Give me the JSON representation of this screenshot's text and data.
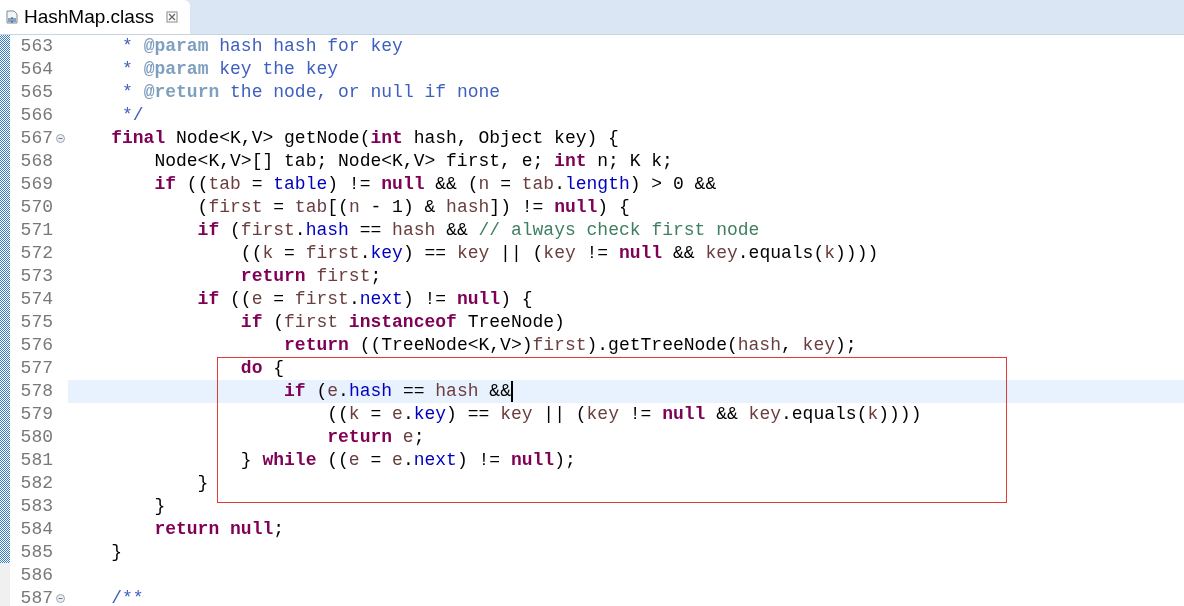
{
  "tab": {
    "title": "HashMap.class",
    "selected": true
  },
  "lines": [
    {
      "number": "563",
      "foldable": false,
      "current": false,
      "tokens": [
        {
          "kind": "doc",
          "text": "     * "
        },
        {
          "kind": "tag",
          "text": "@param"
        },
        {
          "kind": "doc",
          "text": " hash hash for key"
        }
      ]
    },
    {
      "number": "564",
      "foldable": false,
      "current": false,
      "tokens": [
        {
          "kind": "doc",
          "text": "     * "
        },
        {
          "kind": "tag",
          "text": "@param"
        },
        {
          "kind": "doc",
          "text": " key the key"
        }
      ]
    },
    {
      "number": "565",
      "foldable": false,
      "current": false,
      "tokens": [
        {
          "kind": "doc",
          "text": "     * "
        },
        {
          "kind": "tag",
          "text": "@return"
        },
        {
          "kind": "doc",
          "text": " the node, or null if none"
        }
      ]
    },
    {
      "number": "566",
      "foldable": false,
      "current": false,
      "tokens": [
        {
          "kind": "doc",
          "text": "     */"
        }
      ]
    },
    {
      "number": "567",
      "foldable": true,
      "current": false,
      "tokens": [
        {
          "kind": "kw",
          "text": "    final"
        },
        {
          "kind": "txt",
          "text": " Node<K,V> getNode("
        },
        {
          "kind": "kw",
          "text": "int"
        },
        {
          "kind": "txt",
          "text": " hash, Object key) {"
        }
      ]
    },
    {
      "number": "568",
      "foldable": false,
      "current": false,
      "tokens": [
        {
          "kind": "txt",
          "text": "        Node<K,V>[] tab; Node<K,V> first, e; "
        },
        {
          "kind": "kw",
          "text": "int"
        },
        {
          "kind": "txt",
          "text": " n; K k;"
        }
      ]
    },
    {
      "number": "569",
      "foldable": false,
      "current": false,
      "tokens": [
        {
          "kind": "kw",
          "text": "        if"
        },
        {
          "kind": "txt",
          "text": " (("
        },
        {
          "kind": "var",
          "text": "tab"
        },
        {
          "kind": "txt",
          "text": " = "
        },
        {
          "kind": "fld",
          "text": "table"
        },
        {
          "kind": "txt",
          "text": ") != "
        },
        {
          "kind": "kw",
          "text": "null"
        },
        {
          "kind": "txt",
          "text": " && ("
        },
        {
          "kind": "var",
          "text": "n"
        },
        {
          "kind": "txt",
          "text": " = "
        },
        {
          "kind": "var",
          "text": "tab"
        },
        {
          "kind": "txt",
          "text": "."
        },
        {
          "kind": "fld",
          "text": "length"
        },
        {
          "kind": "txt",
          "text": ") > 0 &&"
        }
      ]
    },
    {
      "number": "570",
      "foldable": false,
      "current": false,
      "tokens": [
        {
          "kind": "txt",
          "text": "            ("
        },
        {
          "kind": "var",
          "text": "first"
        },
        {
          "kind": "txt",
          "text": " = "
        },
        {
          "kind": "var",
          "text": "tab"
        },
        {
          "kind": "txt",
          "text": "[("
        },
        {
          "kind": "var",
          "text": "n"
        },
        {
          "kind": "txt",
          "text": " - 1) & "
        },
        {
          "kind": "var",
          "text": "hash"
        },
        {
          "kind": "txt",
          "text": "]) != "
        },
        {
          "kind": "kw",
          "text": "null"
        },
        {
          "kind": "txt",
          "text": ") {"
        }
      ]
    },
    {
      "number": "571",
      "foldable": false,
      "current": false,
      "tokens": [
        {
          "kind": "kw",
          "text": "            if"
        },
        {
          "kind": "txt",
          "text": " ("
        },
        {
          "kind": "var",
          "text": "first"
        },
        {
          "kind": "txt",
          "text": "."
        },
        {
          "kind": "fld",
          "text": "hash"
        },
        {
          "kind": "txt",
          "text": " == "
        },
        {
          "kind": "var",
          "text": "hash"
        },
        {
          "kind": "txt",
          "text": " && "
        },
        {
          "kind": "cmt",
          "text": "// always check first node"
        }
      ]
    },
    {
      "number": "572",
      "foldable": false,
      "current": false,
      "tokens": [
        {
          "kind": "txt",
          "text": "                (("
        },
        {
          "kind": "var",
          "text": "k"
        },
        {
          "kind": "txt",
          "text": " = "
        },
        {
          "kind": "var",
          "text": "first"
        },
        {
          "kind": "txt",
          "text": "."
        },
        {
          "kind": "fld",
          "text": "key"
        },
        {
          "kind": "txt",
          "text": ") == "
        },
        {
          "kind": "var",
          "text": "key"
        },
        {
          "kind": "txt",
          "text": " || ("
        },
        {
          "kind": "var",
          "text": "key"
        },
        {
          "kind": "txt",
          "text": " != "
        },
        {
          "kind": "kw",
          "text": "null"
        },
        {
          "kind": "txt",
          "text": " && "
        },
        {
          "kind": "var",
          "text": "key"
        },
        {
          "kind": "txt",
          "text": ".equals("
        },
        {
          "kind": "var",
          "text": "k"
        },
        {
          "kind": "txt",
          "text": "))))"
        }
      ]
    },
    {
      "number": "573",
      "foldable": false,
      "current": false,
      "tokens": [
        {
          "kind": "kw",
          "text": "                return "
        },
        {
          "kind": "var",
          "text": "first"
        },
        {
          "kind": "txt",
          "text": ";"
        }
      ]
    },
    {
      "number": "574",
      "foldable": false,
      "current": false,
      "tokens": [
        {
          "kind": "kw",
          "text": "            if"
        },
        {
          "kind": "txt",
          "text": " (("
        },
        {
          "kind": "var",
          "text": "e"
        },
        {
          "kind": "txt",
          "text": " = "
        },
        {
          "kind": "var",
          "text": "first"
        },
        {
          "kind": "txt",
          "text": "."
        },
        {
          "kind": "fld",
          "text": "next"
        },
        {
          "kind": "txt",
          "text": ") != "
        },
        {
          "kind": "kw",
          "text": "null"
        },
        {
          "kind": "txt",
          "text": ") {"
        }
      ]
    },
    {
      "number": "575",
      "foldable": false,
      "current": false,
      "tokens": [
        {
          "kind": "kw",
          "text": "                if"
        },
        {
          "kind": "txt",
          "text": " ("
        },
        {
          "kind": "var",
          "text": "first "
        },
        {
          "kind": "kw",
          "text": "instanceof"
        },
        {
          "kind": "txt",
          "text": " TreeNode)"
        }
      ]
    },
    {
      "number": "576",
      "foldable": false,
      "current": false,
      "tokens": [
        {
          "kind": "kw",
          "text": "                    return"
        },
        {
          "kind": "txt",
          "text": " ((TreeNode<K,V>)"
        },
        {
          "kind": "var",
          "text": "first"
        },
        {
          "kind": "txt",
          "text": ").getTreeNode("
        },
        {
          "kind": "var",
          "text": "hash"
        },
        {
          "kind": "txt",
          "text": ", "
        },
        {
          "kind": "var",
          "text": "key"
        },
        {
          "kind": "txt",
          "text": ");"
        }
      ]
    },
    {
      "number": "577",
      "foldable": false,
      "current": false,
      "tokens": [
        {
          "kind": "kw",
          "text": "                do"
        },
        {
          "kind": "txt",
          "text": " {"
        }
      ]
    },
    {
      "number": "578",
      "foldable": false,
      "current": true,
      "tokens": [
        {
          "kind": "kw",
          "text": "                    if"
        },
        {
          "kind": "txt",
          "text": " ("
        },
        {
          "kind": "var",
          "text": "e"
        },
        {
          "kind": "txt",
          "text": "."
        },
        {
          "kind": "fld",
          "text": "hash"
        },
        {
          "kind": "txt",
          "text": " == "
        },
        {
          "kind": "var",
          "text": "hash"
        },
        {
          "kind": "txt",
          "text": " &&"
        }
      ]
    },
    {
      "number": "579",
      "foldable": false,
      "current": false,
      "tokens": [
        {
          "kind": "txt",
          "text": "                        (("
        },
        {
          "kind": "var",
          "text": "k"
        },
        {
          "kind": "txt",
          "text": " = "
        },
        {
          "kind": "var",
          "text": "e"
        },
        {
          "kind": "txt",
          "text": "."
        },
        {
          "kind": "fld",
          "text": "key"
        },
        {
          "kind": "txt",
          "text": ") == "
        },
        {
          "kind": "var",
          "text": "key"
        },
        {
          "kind": "txt",
          "text": " || ("
        },
        {
          "kind": "var",
          "text": "key"
        },
        {
          "kind": "txt",
          "text": " != "
        },
        {
          "kind": "kw",
          "text": "null"
        },
        {
          "kind": "txt",
          "text": " && "
        },
        {
          "kind": "var",
          "text": "key"
        },
        {
          "kind": "txt",
          "text": ".equals("
        },
        {
          "kind": "var",
          "text": "k"
        },
        {
          "kind": "txt",
          "text": "))))"
        }
      ]
    },
    {
      "number": "580",
      "foldable": false,
      "current": false,
      "tokens": [
        {
          "kind": "kw",
          "text": "                        return "
        },
        {
          "kind": "var",
          "text": "e"
        },
        {
          "kind": "txt",
          "text": ";"
        }
      ]
    },
    {
      "number": "581",
      "foldable": false,
      "current": false,
      "tokens": [
        {
          "kind": "txt",
          "text": "                } "
        },
        {
          "kind": "kw",
          "text": "while"
        },
        {
          "kind": "txt",
          "text": " (("
        },
        {
          "kind": "var",
          "text": "e"
        },
        {
          "kind": "txt",
          "text": " = "
        },
        {
          "kind": "var",
          "text": "e"
        },
        {
          "kind": "txt",
          "text": "."
        },
        {
          "kind": "fld",
          "text": "next"
        },
        {
          "kind": "txt",
          "text": ") != "
        },
        {
          "kind": "kw",
          "text": "null"
        },
        {
          "kind": "txt",
          "text": ");"
        }
      ]
    },
    {
      "number": "582",
      "foldable": false,
      "current": false,
      "tokens": [
        {
          "kind": "txt",
          "text": "            }"
        }
      ]
    },
    {
      "number": "583",
      "foldable": false,
      "current": false,
      "tokens": [
        {
          "kind": "txt",
          "text": "        }"
        }
      ]
    },
    {
      "number": "584",
      "foldable": false,
      "current": false,
      "tokens": [
        {
          "kind": "kw",
          "text": "        return null"
        },
        {
          "kind": "txt",
          "text": ";"
        }
      ]
    },
    {
      "number": "585",
      "foldable": false,
      "current": false,
      "tokens": [
        {
          "kind": "txt",
          "text": "    }"
        }
      ]
    },
    {
      "number": "586",
      "foldable": false,
      "current": false
    },
    {
      "number": "587",
      "foldable": true,
      "current": false,
      "tokens": [
        {
          "kind": "doc",
          "text": "    /**"
        }
      ]
    }
  ]
}
